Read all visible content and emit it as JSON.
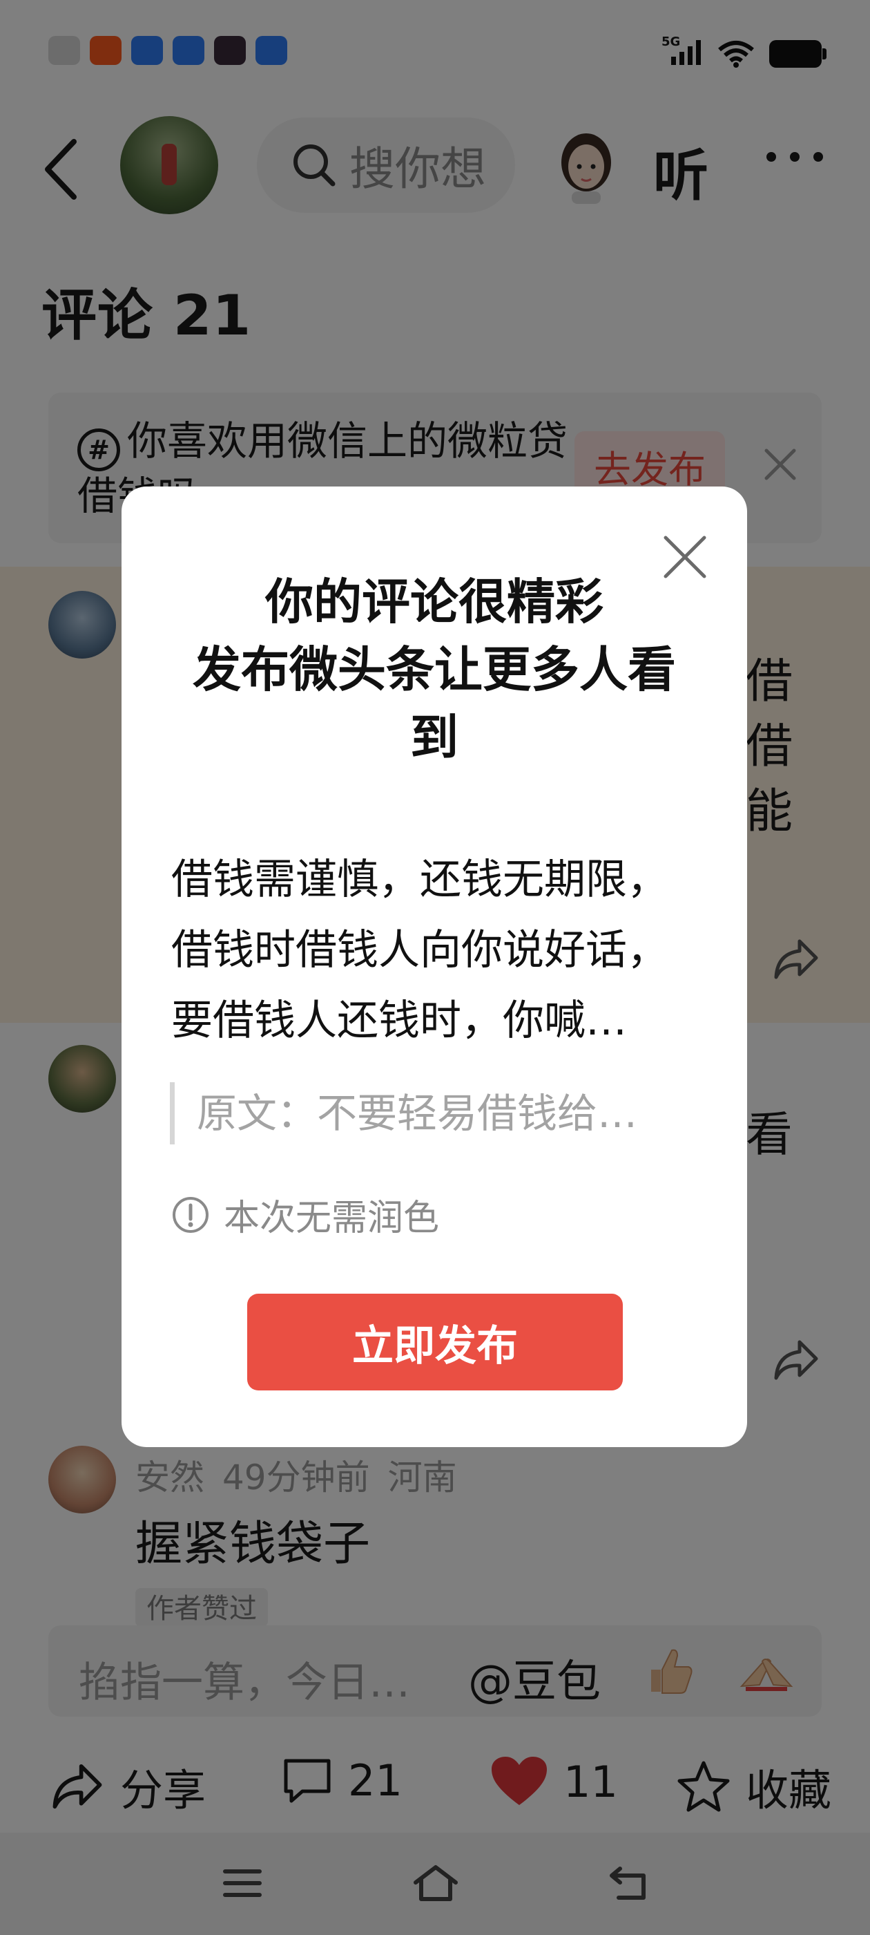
{
  "status_bar": {
    "network": "5G"
  },
  "header": {
    "search_placeholder": "搜你想",
    "listen_label": "听"
  },
  "comments": {
    "title": "评论 21",
    "prompt_text": "你喜欢用微信上的微粒贷借钱吗",
    "prompt_button": "去发布",
    "peek_text_1": [
      "借",
      "借",
      "能"
    ],
    "peek_text_2": "看",
    "item3": {
      "user": "安然",
      "time": "49分钟前",
      "location": "河南",
      "text": "握紧钱袋子",
      "tag": "作者赞过"
    }
  },
  "input_bar": {
    "placeholder": "掐指一算，今日…",
    "mention": "@豆包"
  },
  "actions": {
    "share": "分享",
    "comment_count": "21",
    "like_count": "11",
    "favorite": "收藏"
  },
  "modal": {
    "title_line1": "你的评论很精彩",
    "title_line2": "发布微头条让更多人看",
    "title_line3": "到",
    "body_line1": "借钱需谨慎，还钱无期限，",
    "body_line2": "借钱时借钱人向你说好话，",
    "body_line3": "要借钱人还钱时，你喊…",
    "original": "原文：不要轻易借钱给…",
    "note": "本次无需润色",
    "publish_button": "立即发布"
  },
  "colors": {
    "accent": "#ea4f43",
    "highlight_bg": "#fdf1de",
    "like": "#e0363a"
  }
}
